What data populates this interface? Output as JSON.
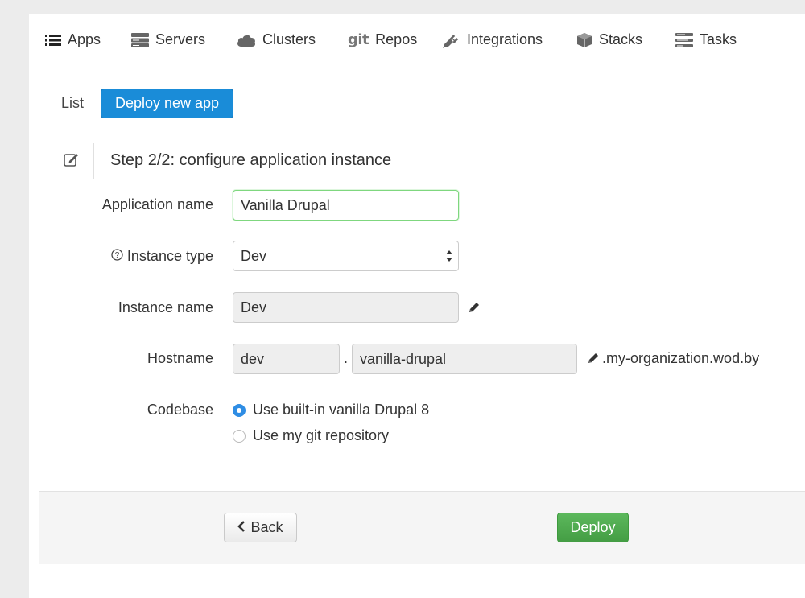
{
  "tabs": [
    {
      "label": "Apps",
      "icon": "list-icon",
      "active": true
    },
    {
      "label": "Servers",
      "icon": "servers-icon",
      "active": false
    },
    {
      "label": "Clusters",
      "icon": "cloud-icon",
      "active": false
    },
    {
      "label": "Repos",
      "icon": "git-icon",
      "prefix": "git",
      "active": false
    },
    {
      "label": "Integrations",
      "icon": "plug-icon",
      "active": false
    },
    {
      "label": "Stacks",
      "icon": "cube-icon",
      "active": false
    },
    {
      "label": "Tasks",
      "icon": "tasks-icon",
      "active": false
    }
  ],
  "subnav": {
    "list_label": "List",
    "deploy_label": "Deploy new app"
  },
  "step": {
    "title": "Step 2/2: configure application instance",
    "icon": "edit-icon"
  },
  "form": {
    "app_name_label": "Application name",
    "app_name_value": "Vanilla Drupal",
    "instance_type_label": "Instance type",
    "instance_type_value": "Dev",
    "instance_name_label": "Instance name",
    "instance_name_value": "Dev",
    "hostname_label": "Hostname",
    "hostname_prefix": "dev",
    "hostname_dot": ".",
    "hostname_value": "vanilla-drupal",
    "hostname_suffix": ".my-organization.wod.by",
    "codebase_label": "Codebase",
    "codebase_options": [
      {
        "label": "Use built-in vanilla Drupal 8",
        "checked": true
      },
      {
        "label": "Use my git repository",
        "checked": false
      }
    ]
  },
  "footer": {
    "back_label": "Back",
    "deploy_label": "Deploy"
  },
  "colors": {
    "primary": "#1a8cd8",
    "success": "#5cb85c",
    "radio": "#2f8de4"
  }
}
